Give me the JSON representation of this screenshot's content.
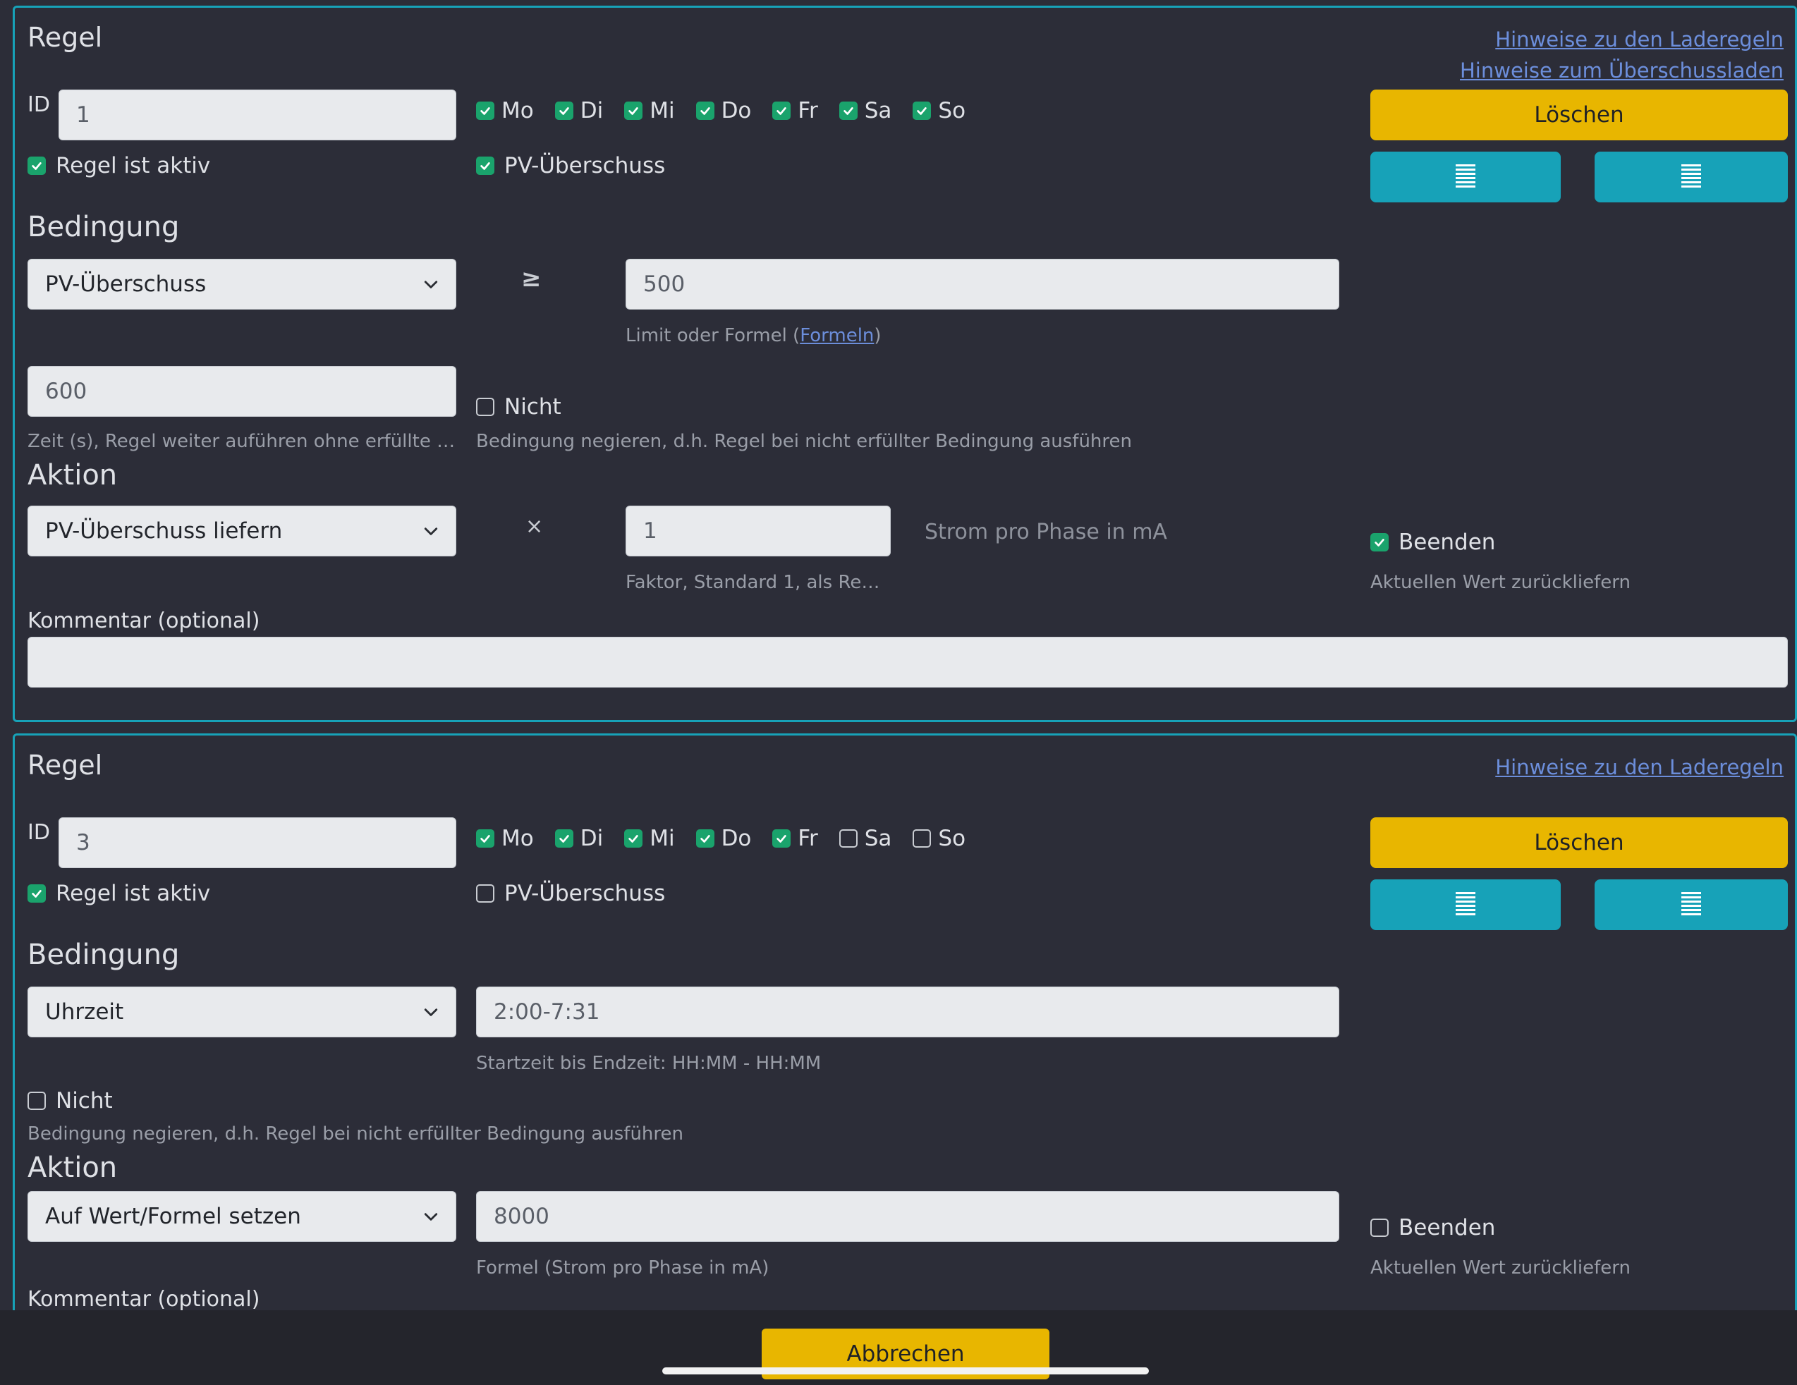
{
  "colors": {
    "background": "#2c2d38",
    "accent": "#17a2b8",
    "warning": "#e8b600",
    "check": "#1aa36c"
  },
  "rules": [
    {
      "title": "Regel",
      "links": [
        "Hinweise zu den Laderegeln",
        "Hinweise zum Überschussladen"
      ],
      "id_label": "ID",
      "id_value": "1",
      "days": [
        {
          "label": "Mo",
          "checked": true
        },
        {
          "label": "Di",
          "checked": true
        },
        {
          "label": "Mi",
          "checked": true
        },
        {
          "label": "Do",
          "checked": true
        },
        {
          "label": "Fr",
          "checked": true
        },
        {
          "label": "Sa",
          "checked": true
        },
        {
          "label": "So",
          "checked": true
        }
      ],
      "active_label": "Regel ist aktiv",
      "active_checked": true,
      "pv_label": "PV-Überschuss",
      "pv_checked": true,
      "delete_label": "Löschen",
      "condition_heading": "Bedingung",
      "condition_select": "PV-Überschuss",
      "condition_operator": "≥",
      "condition_value": "500",
      "condition_help_prefix": "Limit oder Formel (",
      "condition_help_link": "Formeln",
      "condition_help_suffix": ")",
      "time_value": "600",
      "time_help": "Zeit (s), Regel weiter auführen ohne erfüllte B...",
      "not_label": "Nicht",
      "not_checked": false,
      "not_help": "Bedingung negieren, d.h. Regel bei nicht erfüllter Bedingung ausführen",
      "action_heading": "Aktion",
      "action_select": "PV-Überschuss liefern",
      "action_operator": "×",
      "action_value": "1",
      "action_help": "Faktor, Standard 1, als Regel...",
      "action_unit": "Strom pro Phase in mA",
      "end_label": "Beenden",
      "end_checked": true,
      "end_help": "Aktuellen Wert zurückliefern",
      "comment_label": "Kommentar (optional)",
      "comment_value": ""
    },
    {
      "title": "Regel",
      "links": [
        "Hinweise zu den Laderegeln"
      ],
      "id_label": "ID",
      "id_value": "3",
      "days": [
        {
          "label": "Mo",
          "checked": true
        },
        {
          "label": "Di",
          "checked": true
        },
        {
          "label": "Mi",
          "checked": true
        },
        {
          "label": "Do",
          "checked": true
        },
        {
          "label": "Fr",
          "checked": true
        },
        {
          "label": "Sa",
          "checked": false
        },
        {
          "label": "So",
          "checked": false
        }
      ],
      "active_label": "Regel ist aktiv",
      "active_checked": true,
      "pv_label": "PV-Überschuss",
      "pv_checked": false,
      "delete_label": "Löschen",
      "condition_heading": "Bedingung",
      "condition_select": "Uhrzeit",
      "condition_value": "2:00-7:31",
      "condition_help": "Startzeit bis Endzeit: HH:MM - HH:MM",
      "not_label": "Nicht",
      "not_checked": false,
      "not_help": "Bedingung negieren, d.h. Regel bei nicht erfüllter Bedingung ausführen",
      "action_heading": "Aktion",
      "action_select": "Auf Wert/Formel setzen",
      "action_value": "8000",
      "action_help": "Formel (Strom pro Phase in mA)",
      "end_label": "Beenden",
      "end_checked": false,
      "end_help": "Aktuellen Wert zurückliefern",
      "comment_label": "Kommentar (optional)"
    }
  ],
  "footer": {
    "cancel_label": "Abbrechen"
  }
}
